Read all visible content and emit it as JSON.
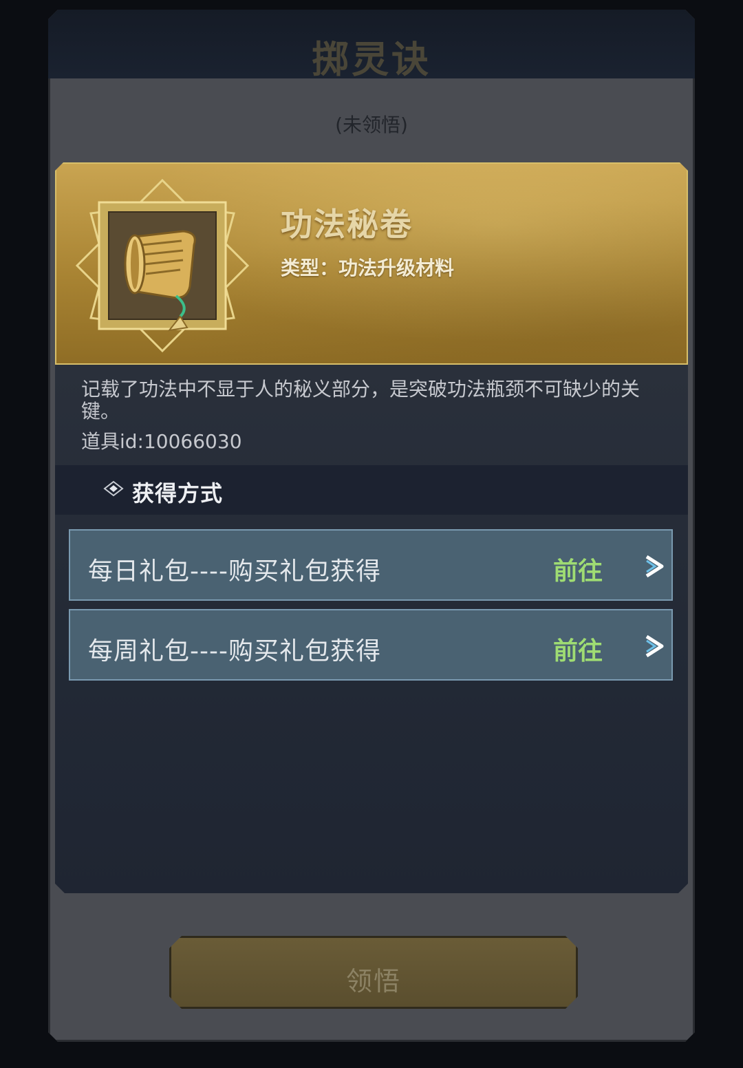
{
  "dialog": {
    "title": "掷灵诀",
    "status": "(未领悟)"
  },
  "item": {
    "name": "功法秘卷",
    "type_text": "类型：功法升级材料",
    "description": "记载了功法中不显于人的秘义部分，是突破功法瓶颈不可缺少的关键。",
    "id_text": "道具id:10066030",
    "icon": "scroll-icon"
  },
  "acquisition": {
    "title": "获得方式",
    "sources": [
      {
        "label": "每日礼包----购买礼包获得",
        "action": "前往"
      },
      {
        "label": "每周礼包----购买礼包获得",
        "action": "前往"
      }
    ]
  },
  "learn_button": {
    "label": "领悟"
  },
  "colors": {
    "goto_green": "#9fdc73",
    "gold_card": "#c9a451",
    "row_blue": "#4a6272"
  }
}
